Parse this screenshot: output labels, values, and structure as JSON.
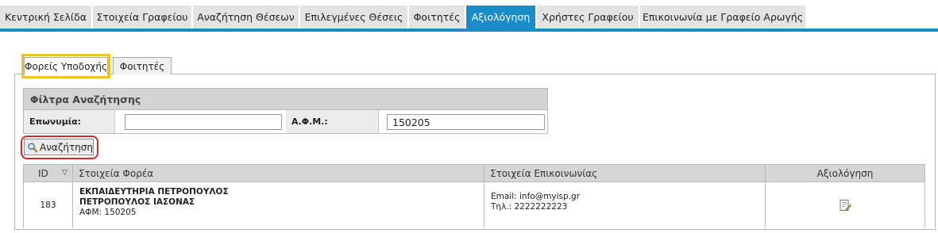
{
  "nav": {
    "tabs": [
      {
        "label": "Κεντρική Σελίδα",
        "active": false
      },
      {
        "label": "Στοιχεία Γραφείου",
        "active": false
      },
      {
        "label": "Αναζήτηση Θέσεων",
        "active": false
      },
      {
        "label": "Επιλεγμένες Θέσεις",
        "active": false
      },
      {
        "label": "Φοιτητές",
        "active": false
      },
      {
        "label": "Αξιολόγηση",
        "active": true
      },
      {
        "label": "Χρήστες Γραφείου",
        "active": false
      },
      {
        "label": "Επικοινωνία με Γραφείο Αρωγής",
        "active": false
      }
    ],
    "accent_color": "#1b8cc8"
  },
  "subtabs": [
    {
      "label": "Φορείς Υποδοχής",
      "active": true
    },
    {
      "label": "Φοιτητές",
      "active": false
    }
  ],
  "filter": {
    "title": "Φίλτρα Αναζήτησης",
    "surname_label": "Επωνυμία:",
    "surname_value": "",
    "afm_label": "Α.Φ.Μ.:",
    "afm_value": "150205"
  },
  "search_button": {
    "label": "Αναζήτηση",
    "icon": "magnifier-icon"
  },
  "results": {
    "columns": [
      "ID",
      "Στοιχεία Φορέα",
      "Στοιχεία Επικοινωνίας",
      "Αξιολόγηση"
    ],
    "sort_indicator": "▽",
    "rows": [
      {
        "id": "183",
        "name_line1": "ΕΚΠΑΙΔΕΥΤΗΡΙΑ ΠΕΤΡΟΠΟΥΛΟΣ",
        "name_line2": "ΠΕΤΡΟΠΟΥΛΟΣ ΙΑΣΟΝΑΣ",
        "afm": "ΑΦΜ: 150205",
        "email": "Email: info@myisp.gr",
        "phone": "Τηλ.: 2222222223",
        "evaluate_icon": "edit-document-icon"
      }
    ]
  }
}
